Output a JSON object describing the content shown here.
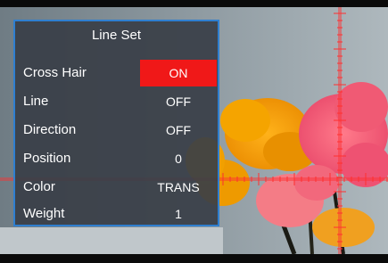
{
  "menu": {
    "title": "Line Set",
    "items": [
      {
        "label": "Cross Hair",
        "value": "ON",
        "selected": true
      },
      {
        "label": "Line",
        "value": "OFF",
        "selected": false
      },
      {
        "label": "Direction",
        "value": "OFF",
        "selected": false
      },
      {
        "label": "Position",
        "value": "0",
        "selected": false
      },
      {
        "label": "Color",
        "value": "TRANS",
        "selected": false
      },
      {
        "label": "Weight",
        "value": "1",
        "selected": false
      }
    ]
  },
  "colors": {
    "panel_border": "#2f7fd0",
    "selected_highlight": "#f01818",
    "crosshair": "#ff3030"
  }
}
